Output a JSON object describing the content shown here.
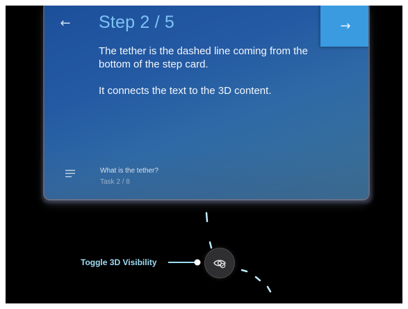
{
  "step_card": {
    "back_icon": "arrow-left-icon",
    "next_icon": "arrow-right-icon",
    "title": "Step 2 / 5",
    "paragraphs": [
      "The tether is the dashed line coming from the bottom of the step card.",
      "It connects the text to the 3D content."
    ],
    "menu_icon": "hamburger-menu-icon",
    "task_title": "What is the tether?",
    "task_progress": "Task 2 / 8"
  },
  "toggle": {
    "label": "Toggle 3D Visibility",
    "icon": "eye-toggle-icon"
  },
  "colors": {
    "card_top": "#1c4f9a",
    "card_bottom": "#3a6f93",
    "title": "#7ec3f5",
    "next_button": "#3a9be0",
    "tether": "#bfe9fb",
    "label": "#9fdcf5",
    "background": "#000000"
  }
}
